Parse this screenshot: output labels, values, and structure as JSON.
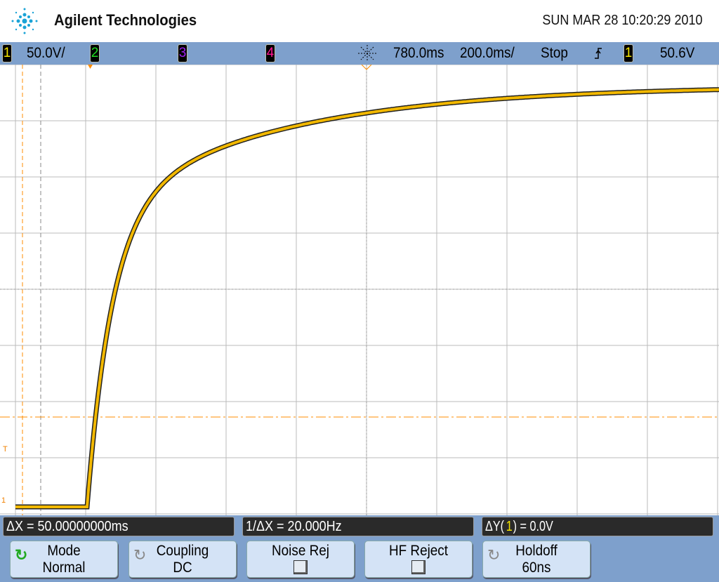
{
  "header": {
    "brand": "Agilent Technologies",
    "datetime": "SUN MAR 28 10:20:29 2010"
  },
  "status_bar": {
    "ch1_label": "1",
    "ch1_scale": "50.0V/",
    "ch2_label": "2",
    "ch3_label": "3",
    "ch4_label": "4",
    "time_delay": "780.0ms",
    "time_scale": "200.0ms/",
    "run_state": "Stop",
    "trigger_source": "1",
    "trigger_level": "50.6V",
    "colors": {
      "ch1": "#f5e400",
      "ch2": "#22dd22",
      "ch3": "#a020f0",
      "ch4": "#ff1493"
    }
  },
  "plot": {
    "trigger_marker": "T",
    "ground_marker": "1",
    "trace_color": "#f2b800",
    "cursor_color": "#ff8c00"
  },
  "measurements": {
    "dx": "ΔX = 50.00000000ms",
    "inv_dx": "1/ΔX = 20.000Hz",
    "dy_prefix": "ΔY(",
    "dy_channel": "1",
    "dy_suffix": ") = 0.0V"
  },
  "softkeys": [
    {
      "top": "Mode",
      "bottom": "Normal"
    },
    {
      "top": "Coupling",
      "bottom": "DC"
    },
    {
      "top": "Noise Rej",
      "checked": false
    },
    {
      "top": "HF Reject",
      "checked": false
    },
    {
      "top": "Holdoff",
      "bottom": "60ns"
    }
  ]
}
